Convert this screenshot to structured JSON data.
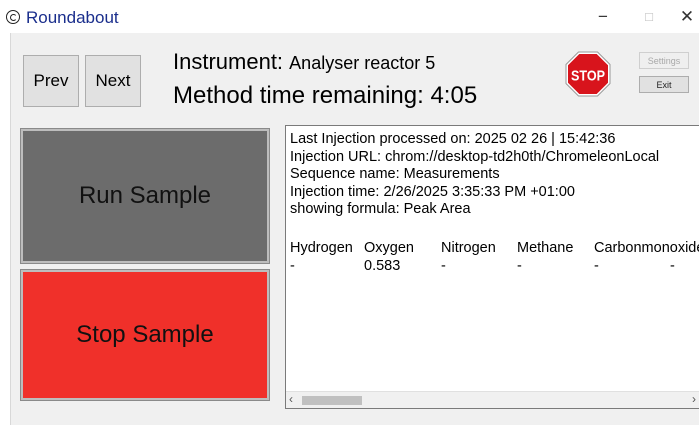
{
  "window": {
    "title": "Roundabout",
    "minimize_glyph": "−",
    "maximize_glyph": "□",
    "close_glyph": "✕"
  },
  "toolbar": {
    "prev_label": "Prev",
    "next_label": "Next",
    "settings_label": "Settings",
    "exit_label": "Exit",
    "stop_sign_text": "STOP"
  },
  "header": {
    "instrument_label": "Instrument:",
    "instrument_name": "Analyser reactor 5",
    "method_label": "Method time remaining:",
    "method_time": "4:05"
  },
  "actions": {
    "run_label": "Run Sample",
    "stop_label": "Stop Sample"
  },
  "info": {
    "last_injection": "Last Injection processed on: 2025 02 26 | 15:42:36",
    "injection_url": "Injection URL: chrom://desktop-td2h0th/ChromeleonLocal",
    "sequence_name": "Sequence name: Measurements",
    "injection_time": "Injection time: 2/26/2025 3:35:33 PM +01:00",
    "formula": "showing formula: Peak Area",
    "columns": [
      "Hydrogen",
      "Oxygen",
      "Nitrogen",
      "Methane",
      "Carbonmonoxide"
    ],
    "values": [
      "-",
      "0.583",
      "-",
      "-",
      "-",
      "-"
    ]
  },
  "colors": {
    "run_button": "#6c6c6c",
    "stop_button": "#f0302a",
    "title_text": "#1a2e8c",
    "stop_sign": "#d8141c"
  }
}
